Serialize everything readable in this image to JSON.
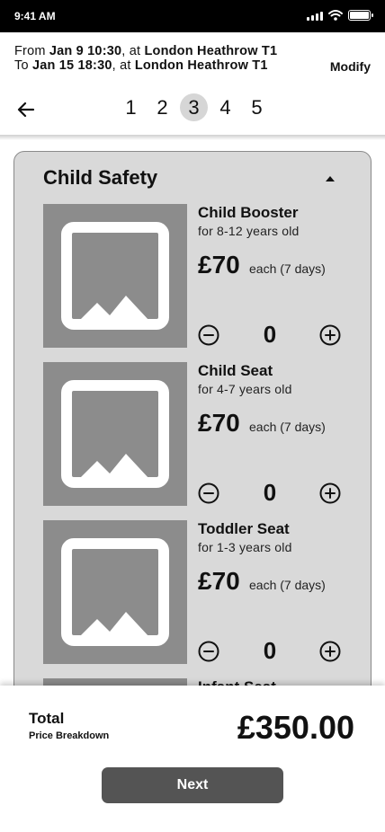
{
  "status_bar": {
    "time": "9:41 AM"
  },
  "trip": {
    "from_prefix": "From ",
    "from_date": "Jan 9 10:30",
    "from_sep": ", at ",
    "from_location": "London Heathrow T1",
    "to_prefix": "To ",
    "to_date": "Jan 15 18:30",
    "to_sep": ", at ",
    "to_location": "London Heathrow T1",
    "modify_label": "Modify"
  },
  "steps": {
    "items": [
      "1",
      "2",
      "3",
      "4",
      "5"
    ],
    "active": "3"
  },
  "section": {
    "title": "Child Safety",
    "products": [
      {
        "name": "Child Booster",
        "age": "for 8-12 years old",
        "price": "£70",
        "unit": "each (7 days)",
        "quantity": "0"
      },
      {
        "name": "Child Seat",
        "age": "for 4-7 years old",
        "price": "£70",
        "unit": "each (7 days)",
        "quantity": "0"
      },
      {
        "name": "Toddler Seat",
        "age": "for 1-3 years old",
        "price": "£70",
        "unit": "each (7 days)",
        "quantity": "0"
      },
      {
        "name": "Infant Seat"
      }
    ]
  },
  "footer": {
    "total_label": "Total",
    "breakdown_label": "Price Breakdown",
    "total_amount": "£350.00",
    "next_label": "Next"
  }
}
